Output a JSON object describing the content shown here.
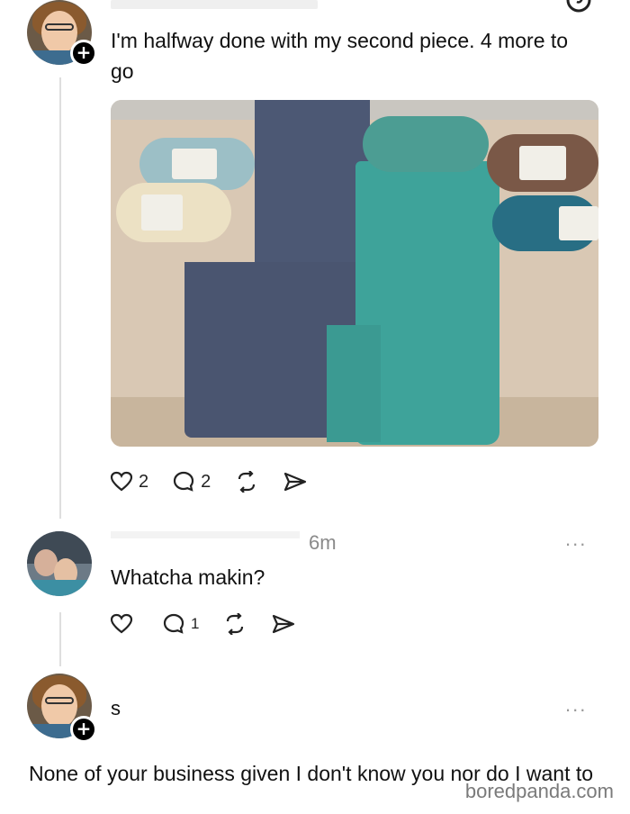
{
  "post": {
    "text": "I'm halfway done with my second piece. 4 more to go",
    "likes": "2",
    "replies": "2",
    "follow_badge": "+"
  },
  "reply1": {
    "time": "6m",
    "text": "Whatcha makin?",
    "replies": "1",
    "more": "..."
  },
  "reply2": {
    "username": "s",
    "text": "None of your business given I don't know you nor do I want to",
    "more": "...",
    "follow_badge": "+"
  },
  "watermark": "boredpanda.com",
  "colors": {
    "navy_blanket": "#4a5570",
    "teal_blanket": "#3ea39a",
    "bed": "#d8c6ae"
  }
}
